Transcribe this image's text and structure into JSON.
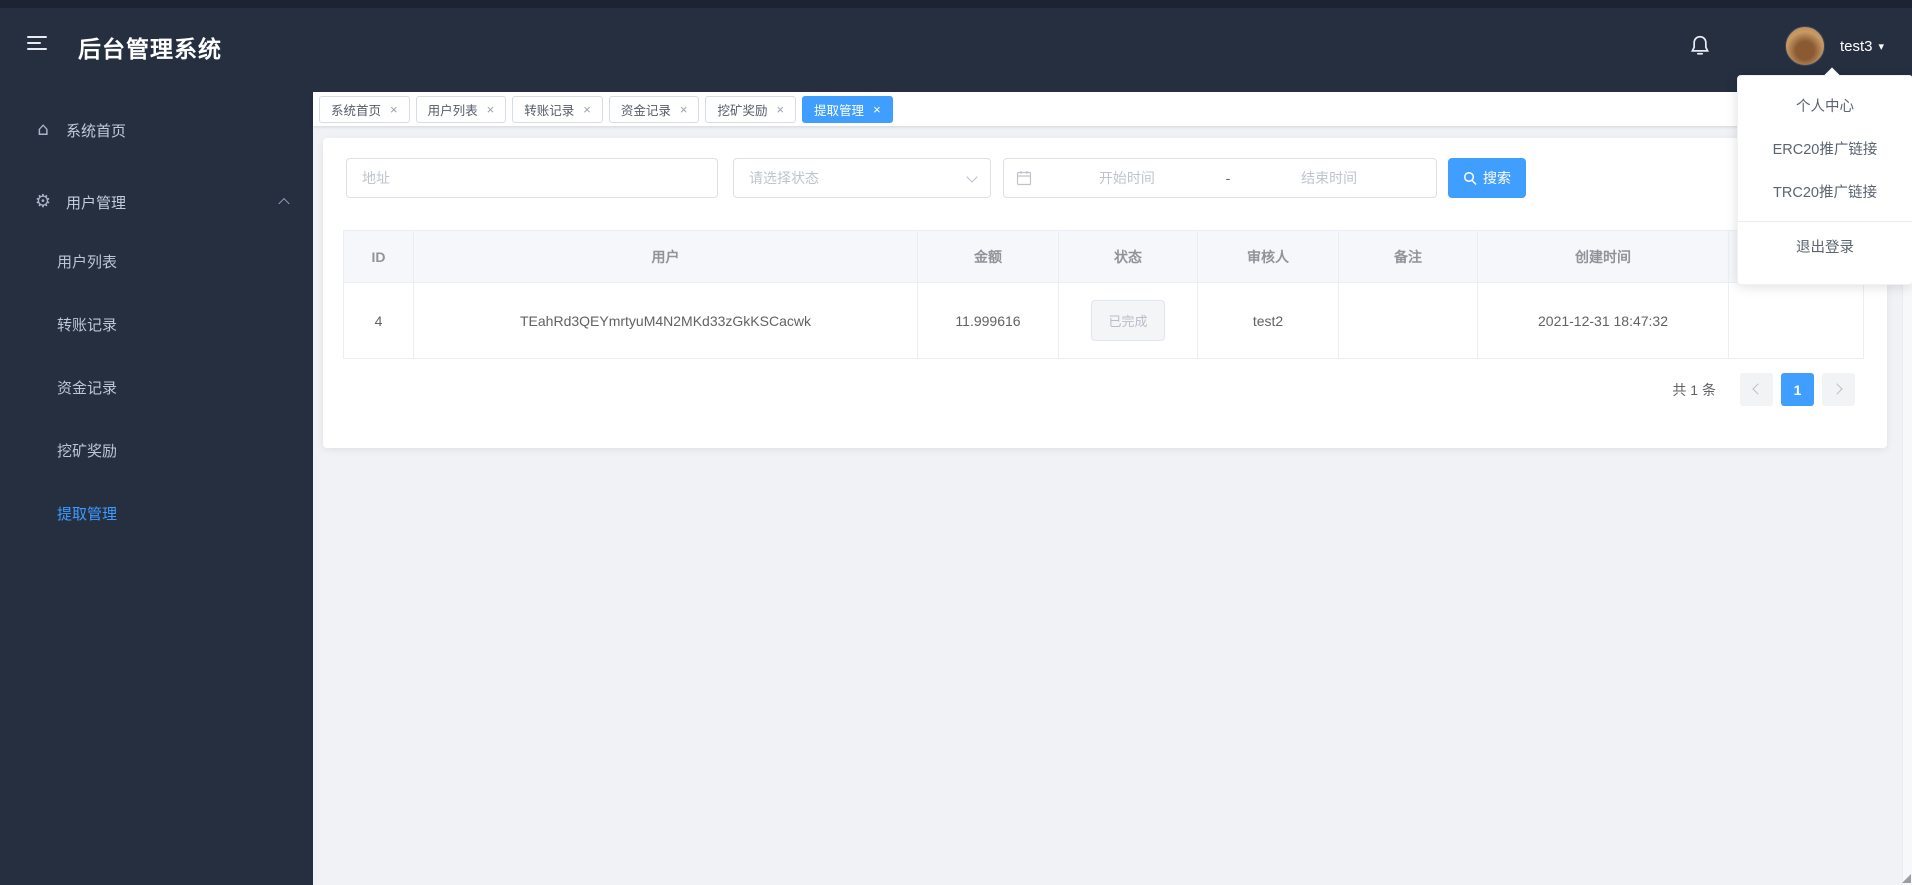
{
  "app": {
    "title": "后台管理系统"
  },
  "header": {
    "username": "test3"
  },
  "user_menu": {
    "items": [
      "个人中心",
      "ERC20推广链接",
      "TRC20推广链接"
    ],
    "logout": "退出登录"
  },
  "sidebar": {
    "home": "系统首页",
    "group": "用户管理",
    "children": [
      "用户列表",
      "转账记录",
      "资金记录",
      "挖矿奖励",
      "提取管理"
    ],
    "active_child": "提取管理"
  },
  "tabs": [
    "系统首页",
    "用户列表",
    "转账记录",
    "资金记录",
    "挖矿奖励",
    "提取管理"
  ],
  "active_tab": "提取管理",
  "filters": {
    "address_placeholder": "地址",
    "status_placeholder": "请选择状态",
    "start_placeholder": "开始时间",
    "range_separator": "-",
    "end_placeholder": "结束时间",
    "search_label": "搜索"
  },
  "table": {
    "columns": [
      "ID",
      "用户",
      "金额",
      "状态",
      "审核人",
      "备注",
      "创建时间",
      ""
    ],
    "row": {
      "id": "4",
      "user": "TEahRd3QEYmrtyuM4N2MKd33zGkKSCacwk",
      "amount": "11.999616",
      "status": "已完成",
      "reviewer": "test2",
      "remark": "",
      "created_at": "2021-12-31 18:47:32"
    }
  },
  "pagination": {
    "total_text": "共 1 条",
    "current_page": "1"
  },
  "icons": {
    "home": "⌂",
    "gear": "⚙",
    "caret_down": "▾",
    "close": "×"
  },
  "colors": {
    "accent": "#409eff",
    "dark_bg": "#252f40",
    "content_bg": "#f0f2f5"
  }
}
